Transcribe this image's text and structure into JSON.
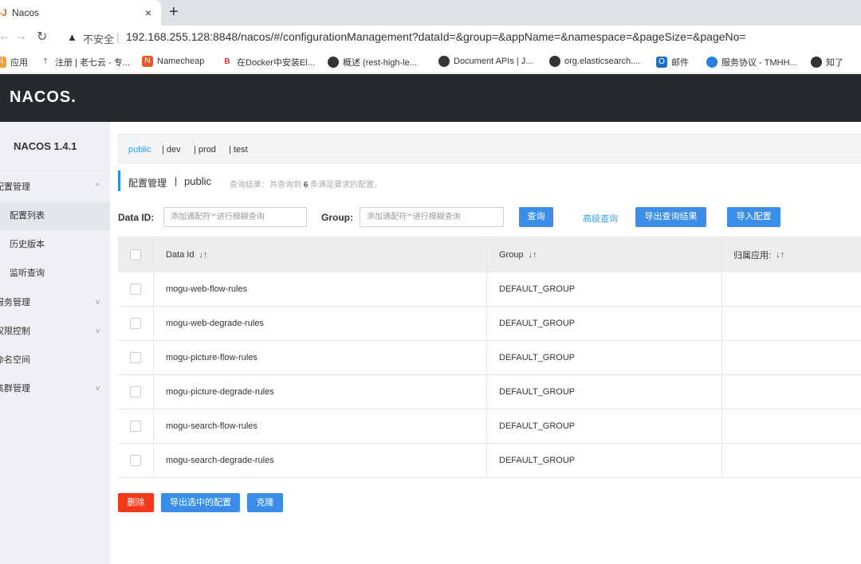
{
  "browser": {
    "tab_title": "Nacos",
    "tab_favicon": "-J",
    "tab_close": "×",
    "new_tab": "+",
    "insecure_label": "不安全",
    "url": "192.168.255.128:8848/nacos/#/configurationManagement?dataId=&group=&appName=&namespace=&pageSize=&pageNo=",
    "bookmarks": [
      {
        "label": "应用",
        "icon": "apps-icon",
        "color": "#e8a33a"
      },
      {
        "label": "注册 | 老七云 - 专...",
        "icon": "bookmark-icon",
        "color": "#555555"
      },
      {
        "label": "Namecheap",
        "icon": "namecheap-icon",
        "color": "#e8562a"
      },
      {
        "label": "在Docker中安装El...",
        "icon": "bookmark-icon",
        "color": "#d93a2b"
      },
      {
        "label": "概述 (rest-high-le...",
        "icon": "globe-icon",
        "color": "#333333"
      },
      {
        "label": "Document APIs | J...",
        "icon": "globe-icon",
        "color": "#333333"
      },
      {
        "label": "org.elasticsearch....",
        "icon": "globe-icon",
        "color": "#333333"
      },
      {
        "label": "邮件",
        "icon": "outlook-icon",
        "color": "#1a6fc4"
      },
      {
        "label": "服务协议 - TMHH...",
        "icon": "bookmark-icon",
        "color": "#2a7de1"
      },
      {
        "label": "知了",
        "icon": "globe-icon",
        "color": "#333333"
      }
    ]
  },
  "header": {
    "logo": "NACOS."
  },
  "sidebar": {
    "version": "NACOS 1.4.1",
    "menu": [
      {
        "label": "配置管理",
        "arrow": "^"
      },
      {
        "label": "服务管理",
        "arrow": "v"
      },
      {
        "label": "权限控制",
        "arrow": "v"
      },
      {
        "label": "命名空间",
        "arrow": ""
      },
      {
        "label": "集群管理",
        "arrow": "v"
      }
    ],
    "sub": [
      "配置列表",
      "历史版本",
      "监听查询"
    ]
  },
  "namespaces": [
    "public",
    "| dev",
    "| prod",
    "| test"
  ],
  "page": {
    "title": "配置管理",
    "sep": "|",
    "namespace": "public",
    "result_prefix": "查询结果：共查询到 ",
    "result_count": "6",
    "result_suffix": " 条满足要求的配置。"
  },
  "filters": {
    "data_id_label": "Data ID:",
    "data_id_placeholder": "添加通配符'*'进行模糊查询",
    "group_label": "Group:",
    "group_placeholder": "添加通配符'*'进行模糊查询",
    "query_button": "查询",
    "advanced_link": "高级查询",
    "export_button": "导出查询结果",
    "import_button": "导入配置"
  },
  "table": {
    "headers": {
      "data_id": "Data Id",
      "group": "Group",
      "app": "归属应用:",
      "sort": "↓↑"
    },
    "rows": [
      {
        "data_id": "mogu-web-flow-rules",
        "group": "DEFAULT_GROUP",
        "app": ""
      },
      {
        "data_id": "mogu-web-degrade-rules",
        "group": "DEFAULT_GROUP",
        "app": ""
      },
      {
        "data_id": "mogu-picture-flow-rules",
        "group": "DEFAULT_GROUP",
        "app": ""
      },
      {
        "data_id": "mogu-picture-degrade-rules",
        "group": "DEFAULT_GROUP",
        "app": ""
      },
      {
        "data_id": "mogu-search-flow-rules",
        "group": "DEFAULT_GROUP",
        "app": ""
      },
      {
        "data_id": "mogu-search-degrade-rules",
        "group": "DEFAULT_GROUP",
        "app": ""
      }
    ]
  },
  "bottom": {
    "delete_button": "删除",
    "export_selected_button": "导出选中的配置",
    "clone_button": "克隆"
  },
  "colors": {
    "primary": "#3b8ee8",
    "danger": "#f23a1a",
    "header_bg": "#252a2f",
    "link": "#3aa0e8"
  }
}
